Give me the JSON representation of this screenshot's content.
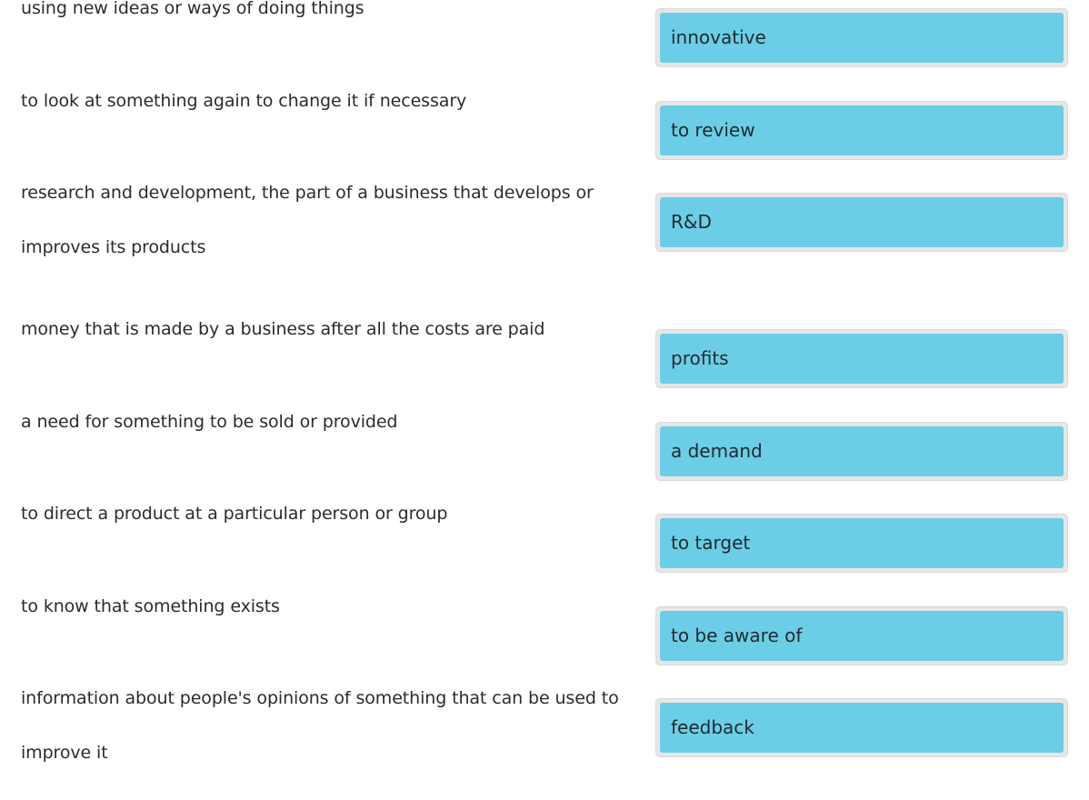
{
  "pairs": [
    {
      "definition": "using new ideas or ways of doing things",
      "answer": "innovative"
    },
    {
      "definition": "to look at something again to change it if necessary",
      "answer": "to review"
    },
    {
      "definition": "research and development, the part of a business that develops or improves its products",
      "answer": "R&D"
    },
    {
      "definition": "money that is made by a business after all the costs are paid",
      "answer": "profits"
    },
    {
      "definition": "a need for something to be sold or provided",
      "answer": "a demand"
    },
    {
      "definition": "to direct a product at a particular person or group",
      "answer": "to target"
    },
    {
      "definition": "to know that something exists",
      "answer": "to be aware of"
    },
    {
      "definition": "information about people's opinions of something that can be used to improve it",
      "answer": "feedback"
    }
  ],
  "colors": {
    "chip": "#6ccde6",
    "slot": "#e6e6e6",
    "text": "#2b2b2b"
  }
}
